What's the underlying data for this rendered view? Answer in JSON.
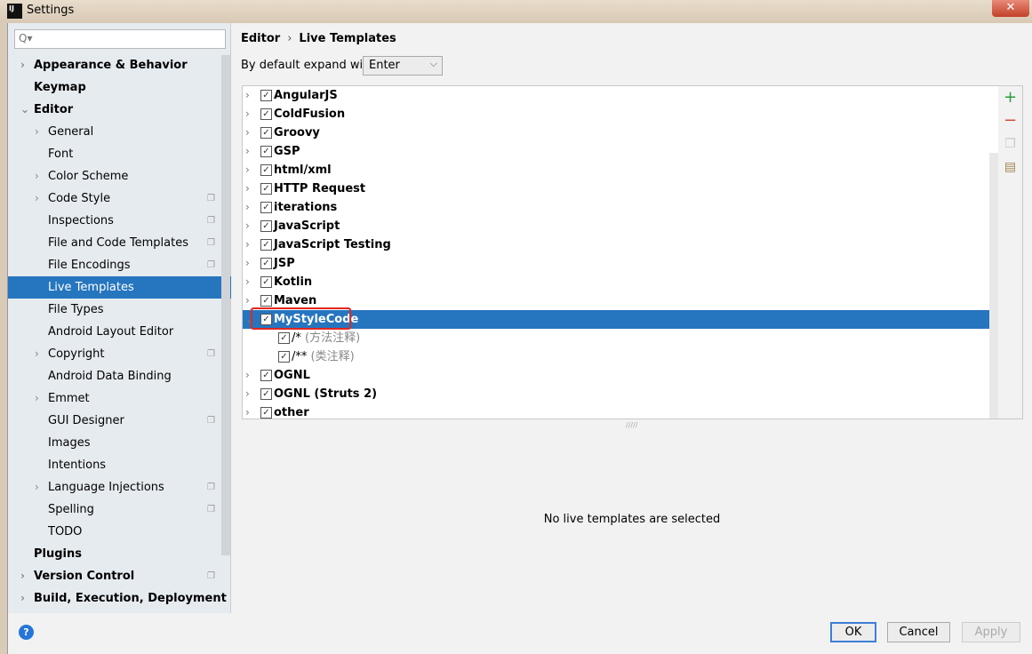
{
  "window": {
    "title": "Settings",
    "logo": "IJ",
    "close": "✕"
  },
  "search": {
    "placeholder": "Q▾"
  },
  "sidebar": {
    "items": [
      {
        "label": "Appearance & Behavior",
        "level": 0,
        "bold": true,
        "arrow": "›",
        "copy": false
      },
      {
        "label": "Keymap",
        "level": 0,
        "bold": true,
        "arrow": "",
        "copy": false
      },
      {
        "label": "Editor",
        "level": 0,
        "bold": true,
        "arrow": "⌄",
        "copy": false
      },
      {
        "label": "General",
        "level": 1,
        "arrow": "›",
        "copy": false
      },
      {
        "label": "Font",
        "level": 1,
        "arrow": "",
        "copy": false
      },
      {
        "label": "Color Scheme",
        "level": 1,
        "arrow": "›",
        "copy": false
      },
      {
        "label": "Code Style",
        "level": 1,
        "arrow": "›",
        "copy": true
      },
      {
        "label": "Inspections",
        "level": 1,
        "arrow": "",
        "copy": true
      },
      {
        "label": "File and Code Templates",
        "level": 1,
        "arrow": "",
        "copy": true
      },
      {
        "label": "File Encodings",
        "level": 1,
        "arrow": "",
        "copy": true
      },
      {
        "label": "Live Templates",
        "level": 1,
        "arrow": "",
        "copy": false,
        "selected": true
      },
      {
        "label": "File Types",
        "level": 1,
        "arrow": "",
        "copy": false
      },
      {
        "label": "Android Layout Editor",
        "level": 1,
        "arrow": "",
        "copy": false
      },
      {
        "label": "Copyright",
        "level": 1,
        "arrow": "›",
        "copy": true
      },
      {
        "label": "Android Data Binding",
        "level": 1,
        "arrow": "",
        "copy": false
      },
      {
        "label": "Emmet",
        "level": 1,
        "arrow": "›",
        "copy": false
      },
      {
        "label": "GUI Designer",
        "level": 1,
        "arrow": "",
        "copy": true
      },
      {
        "label": "Images",
        "level": 1,
        "arrow": "",
        "copy": false
      },
      {
        "label": "Intentions",
        "level": 1,
        "arrow": "",
        "copy": false
      },
      {
        "label": "Language Injections",
        "level": 1,
        "arrow": "›",
        "copy": true
      },
      {
        "label": "Spelling",
        "level": 1,
        "arrow": "",
        "copy": true
      },
      {
        "label": "TODO",
        "level": 1,
        "arrow": "",
        "copy": false
      },
      {
        "label": "Plugins",
        "level": 0,
        "bold": true,
        "arrow": "",
        "copy": false
      },
      {
        "label": "Version Control",
        "level": 0,
        "bold": true,
        "arrow": "›",
        "copy": true
      },
      {
        "label": "Build, Execution, Deployment",
        "level": 0,
        "bold": true,
        "arrow": "›",
        "copy": false
      }
    ]
  },
  "breadcrumb": {
    "parent": "Editor",
    "sep": "›",
    "current": "Live Templates"
  },
  "expand": {
    "label": "By default expand with",
    "value": "Enter"
  },
  "templates": [
    {
      "label": "AngularJS"
    },
    {
      "label": "ColdFusion"
    },
    {
      "label": "Groovy"
    },
    {
      "label": "GSP"
    },
    {
      "label": "html/xml"
    },
    {
      "label": "HTTP Request"
    },
    {
      "label": "iterations"
    },
    {
      "label": "JavaScript"
    },
    {
      "label": "JavaScript Testing"
    },
    {
      "label": "JSP"
    },
    {
      "label": "Kotlin"
    },
    {
      "label": "Maven"
    },
    {
      "label": "MyStyleCode",
      "selected": true,
      "expanded": true
    },
    {
      "label": "/*",
      "desc": " (方法注释)",
      "child": true
    },
    {
      "label": "/**",
      "desc": " (类注释)",
      "child": true
    },
    {
      "label": "OGNL"
    },
    {
      "label": "OGNL (Struts 2)"
    },
    {
      "label": "other"
    }
  ],
  "empty_message": "No live templates are selected",
  "footer": {
    "help": "?",
    "ok": "OK",
    "cancel": "Cancel",
    "apply": "Apply"
  }
}
